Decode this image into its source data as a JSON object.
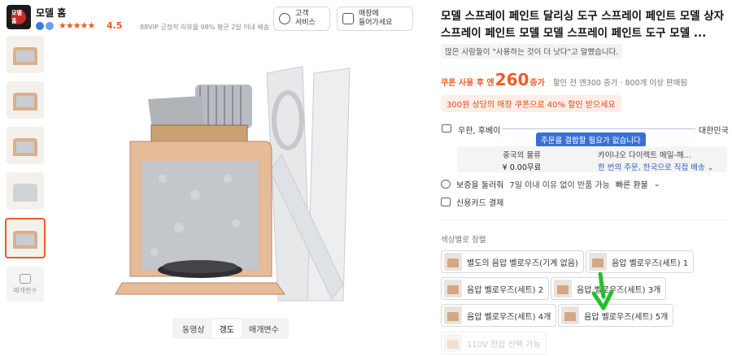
{
  "store": {
    "name": "모델 홈",
    "logo_text": "모델홈",
    "rating": "4.5",
    "stars": "★★★★★",
    "meta": "88VIP 긍정적 리뷰율 98%   평균 2일 이내 배송"
  },
  "header_buttons": {
    "service": "고객\n서비스",
    "store": "매장에\n들어가세요"
  },
  "thumbnails": {
    "count": 5,
    "active_index": 4,
    "more_label": "매개변수"
  },
  "image_tabs": [
    {
      "label": "동영상"
    },
    {
      "label": "갱도"
    },
    {
      "label": "매개변수"
    }
  ],
  "product": {
    "title": "모델 스프레이 페인트 달리싱 도구 스프레이 페인트 모델 상자 스프레이 페인트 모델 모델 스프레이 페인트 도구 모델 ...",
    "review_chip": "많은 사람들이 \"사용하는 것이 더 낫다\"고 말했습니다."
  },
  "price": {
    "label": "쿠폰 사용 후 엔",
    "value": "260",
    "unit": "증가",
    "meta": "할인 전 엔300 증가 · 800개 이상 판매됨",
    "coupon": "300원 상당의 매장 쿠폰으로 40% 할인 받으세요"
  },
  "shipping": {
    "from": "우한, 후베이",
    "to": "대한민국",
    "bubble": "주문을 결합할 필요가 없습니다",
    "left_title": "중국의 물류",
    "left_value": "¥ 0.00무료",
    "right_title": "카이냐오 다이렉트 메일-해...",
    "right_value": "한 번의 주문, 한국으로 직접 배송 ⌄"
  },
  "info": {
    "guarantee_label": "보증을 둘러줘",
    "guarantee_value": "7일 이내 이유 없이 반품 가능",
    "guarantee_fast": "빠른 환불",
    "payment": "신용카드 결제"
  },
  "options": {
    "label": "색상별로 정렬",
    "items": [
      {
        "label": "별도의 음압 벨로우즈(기계 없음)"
      },
      {
        "label": "음압 벨로우즈(세트) 1"
      },
      {
        "label": "음압 벨로우즈(세트) 2"
      },
      {
        "label": "음압 벨로우즈(세트) 3개"
      },
      {
        "label": "음압 벨로우즈(세트) 4개"
      },
      {
        "label": "음압 벨로우즈(세트) 5개"
      },
      {
        "label": "110V 전압 선택 가능"
      }
    ]
  },
  "colors": {
    "accent": "#f05a28",
    "blue": "#3a6fd8",
    "arrow": "#22c02a"
  }
}
